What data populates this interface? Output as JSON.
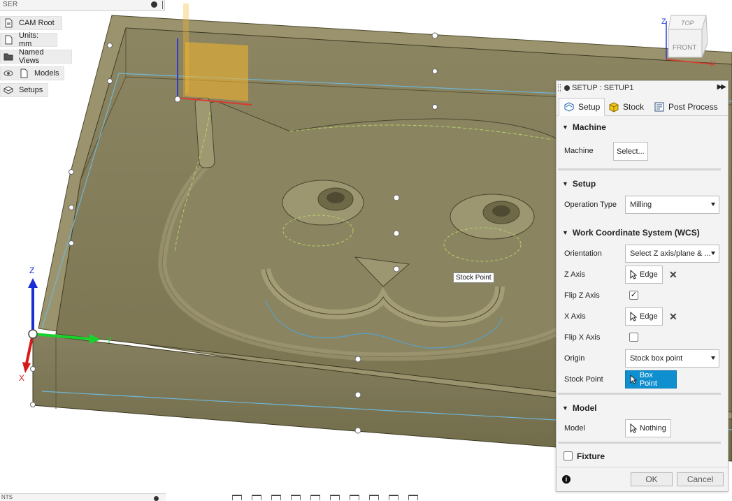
{
  "browser": {
    "header": "SER",
    "items": [
      {
        "label": "CAM Root",
        "icon": "cam-root-icon"
      },
      {
        "label": "Units: mm",
        "icon": "document-icon"
      },
      {
        "label": "Named Views",
        "icon": "folder-icon"
      },
      {
        "label": "Models",
        "icon": "component-icon"
      },
      {
        "label": "Setups",
        "icon": "setups-icon"
      }
    ]
  },
  "viewcube": {
    "top": "TOP",
    "front": "FRONT",
    "z": "Z",
    "x": "X"
  },
  "triad": {
    "z": "Z",
    "y": "Y",
    "x": "X"
  },
  "viewport": {
    "tooltip": "Stock Point"
  },
  "dialog": {
    "title": "SETUP : SETUP1",
    "tabs": [
      {
        "label": "Setup",
        "active": true
      },
      {
        "label": "Stock",
        "active": false
      },
      {
        "label": "Post Process",
        "active": false
      }
    ],
    "machine": {
      "heading": "Machine",
      "machine_label": "Machine",
      "machine_button": "Select..."
    },
    "setup": {
      "heading": "Setup",
      "operation_type_label": "Operation Type",
      "operation_type_value": "Milling"
    },
    "wcs": {
      "heading": "Work Coordinate System (WCS)",
      "orientation_label": "Orientation",
      "orientation_value": "Select Z axis/plane & ...",
      "z_axis_label": "Z Axis",
      "z_axis_value": "Edge",
      "flip_z_label": "Flip Z Axis",
      "flip_z_checked": true,
      "x_axis_label": "X Axis",
      "x_axis_value": "Edge",
      "flip_x_label": "Flip X Axis",
      "flip_x_checked": false,
      "origin_label": "Origin",
      "origin_value": "Stock box point",
      "stock_point_label": "Stock Point",
      "stock_point_value": "Box Point"
    },
    "model": {
      "heading": "Model",
      "model_label": "Model",
      "model_value": "Nothing"
    },
    "fixture": {
      "heading": "Fixture",
      "checked": false
    },
    "footer": {
      "ok": "OK",
      "cancel": "Cancel"
    }
  },
  "bottom_panel": {
    "header": "NTS"
  },
  "colors": {
    "stock_body": "#7d7750",
    "stock_dark": "#5e5a3c",
    "accent_blue": "#0f8fd0",
    "toolpath_blue": "#5aa0c8",
    "toolpath_green": "#b5d36a",
    "highlight_orange": "#f5b72e"
  }
}
